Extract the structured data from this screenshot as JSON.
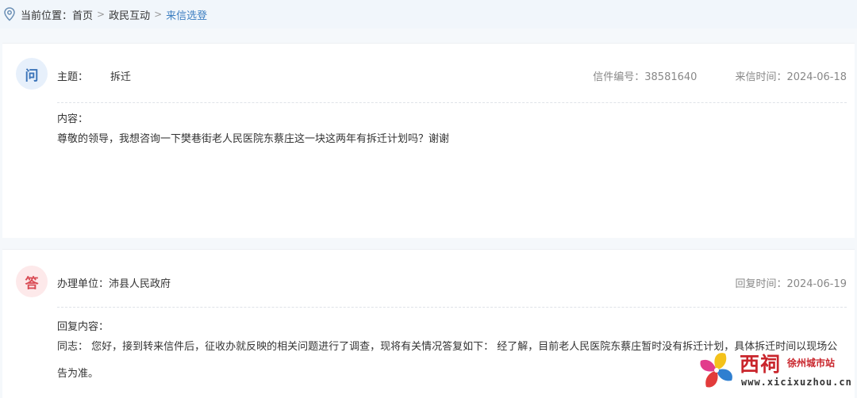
{
  "breadcrumb": {
    "label": "当前位置：",
    "items": [
      "首页",
      "政民互动",
      "来信选登"
    ],
    "separator": ">"
  },
  "question": {
    "badge": "问",
    "subject_key": "主题：",
    "subject": "拆迁",
    "letter_no": "信件编号：38581640",
    "letter_time": "来信时间：2024-06-18",
    "content_label": "内容：",
    "content": "尊敬的领导，我想咨询一下樊巷街老人民医院东蔡庄这一块这两年有拆迁计划吗？谢谢"
  },
  "answer": {
    "badge": "答",
    "unit": "办理单位：沛县人民政府",
    "reply_time": "回复时间：2024-06-19",
    "content_label": "回复内容：",
    "content": "同志： 您好，接到转来信件后，征收办就反映的相关问题进行了调查，现将有关情况答复如下： 经了解，目前老人民医院东蔡庄暂时没有拆迁计划，具体拆迁时间以现场公告为准。"
  },
  "watermark": {
    "brand": "西祠",
    "site": "徐州城市站",
    "url": "www.xicixuzhou.cn"
  },
  "colors": {
    "accent": "#3d7fc1",
    "answer_badge": "#d94b54",
    "question_badge": "#3b74b9",
    "brand_red": "#c9252c"
  }
}
